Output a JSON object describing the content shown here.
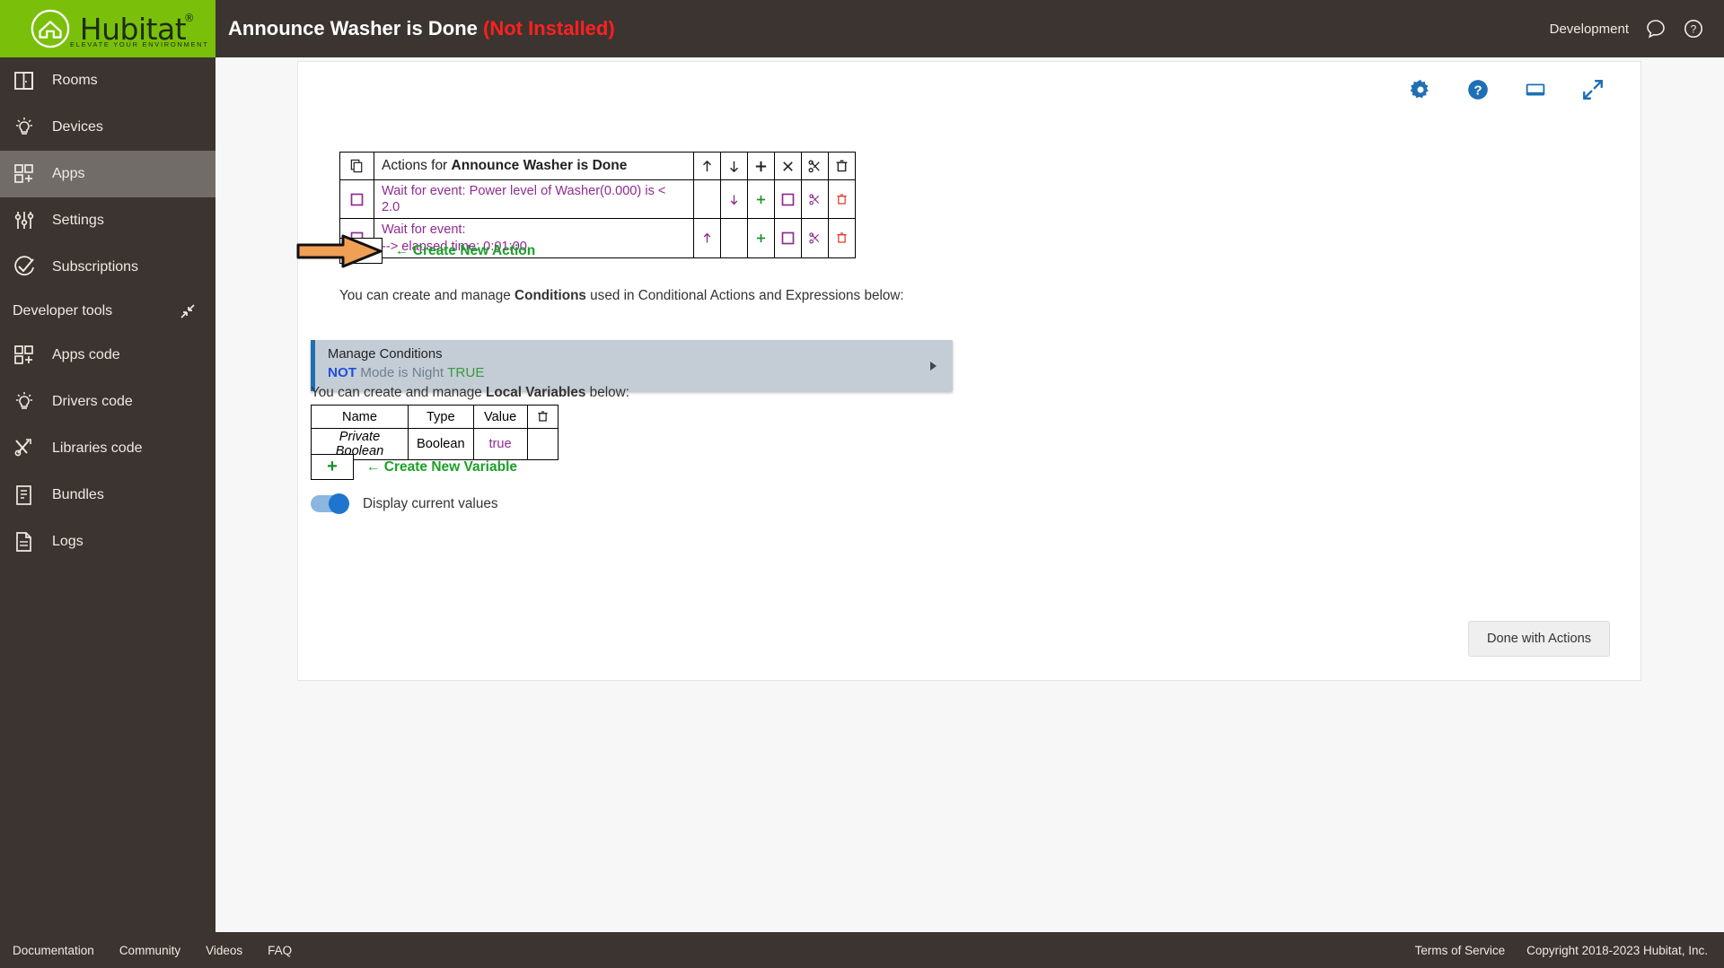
{
  "topbar": {
    "logo_word": "Hubitat",
    "logo_trademark": "®",
    "logo_tagline": "ELEVATE YOUR ENVIRONMENT",
    "app_title": "Announce Washer is Done",
    "app_status": "(Not Installed)",
    "environment_label": "Development",
    "icons": [
      "chat-bubble-icon",
      "help-circle-icon"
    ]
  },
  "sidebar": {
    "items": [
      {
        "label": "Rooms",
        "icon": "rooms-icon",
        "active": false
      },
      {
        "label": "Devices",
        "icon": "bulb-icon",
        "active": false
      },
      {
        "label": "Apps",
        "icon": "apps-icon",
        "active": true
      },
      {
        "label": "Settings",
        "icon": "sliders-icon",
        "active": false
      },
      {
        "label": "Subscriptions",
        "icon": "check-circle-icon",
        "active": false
      }
    ],
    "section_label": "Developer tools",
    "dev_items": [
      {
        "label": "Apps code",
        "icon": "apps-icon"
      },
      {
        "label": "Drivers code",
        "icon": "bulb-icon"
      },
      {
        "label": "Libraries code",
        "icon": "tools-icon"
      },
      {
        "label": "Bundles",
        "icon": "bundle-icon"
      },
      {
        "label": "Logs",
        "icon": "logs-icon"
      }
    ]
  },
  "card": {
    "tool_icons": [
      "gear-icon",
      "help-circle-icon",
      "window-icon",
      "expand-icon"
    ]
  },
  "actions_table": {
    "header": {
      "copy_icon": "copy-icon",
      "title_prefix": "Actions for ",
      "title_name": "Announce Washer is Done",
      "icons": [
        "up-arrow-icon",
        "down-arrow-icon",
        "plus-icon",
        "close-icon",
        "scissors-icon",
        "trash-icon"
      ]
    },
    "rows": [
      {
        "checkbox": "checkbox-icon",
        "line1": "Wait for event: Power level of Washer(0.000) is < 2.0",
        "line2": "",
        "up": false,
        "down": true
      },
      {
        "checkbox": "checkbox-icon",
        "line1": "Wait for event:",
        "line2": "--> elapsed time: 0:01:00",
        "up": true,
        "down": false
      }
    ]
  },
  "create_action": {
    "plus": "+",
    "label": "← Create New Action",
    "pointer_icon": "orange-arrow-pointer"
  },
  "conditions": {
    "intro_pre": "You can create and manage ",
    "intro_bold": "Conditions",
    "intro_post": " used in Conditional Actions and Expressions below:",
    "panel_title": "Manage Conditions",
    "expr_not": "NOT",
    "expr_body": "Mode is Night",
    "expr_value": "TRUE"
  },
  "variables": {
    "intro_pre": "You can create and manage ",
    "intro_bold": "Local Variables",
    "intro_post": " below:",
    "columns": [
      "Name",
      "Type",
      "Value"
    ],
    "delete_icon": "trash-icon",
    "rows": [
      {
        "name": "Private Boolean",
        "type": "Boolean",
        "value": "true"
      }
    ],
    "create_plus": "+",
    "create_label": "← Create New Variable"
  },
  "display_toggle": {
    "label": "Display current values",
    "on": true
  },
  "done_button": {
    "label": "Done with Actions"
  },
  "footer": {
    "left_links": [
      "Documentation",
      "Community",
      "Videos",
      "FAQ"
    ],
    "right_links": [
      "Terms of Service",
      "Copyright 2018-2023 Hubitat, Inc."
    ]
  },
  "colors": {
    "brand_green": "#7ac00a",
    "chrome_brown": "#3b3430",
    "accent_blue": "#1f6fb5",
    "action_purple": "#8e2c92",
    "create_green": "#1aa028",
    "alert_red": "#ff2020"
  }
}
